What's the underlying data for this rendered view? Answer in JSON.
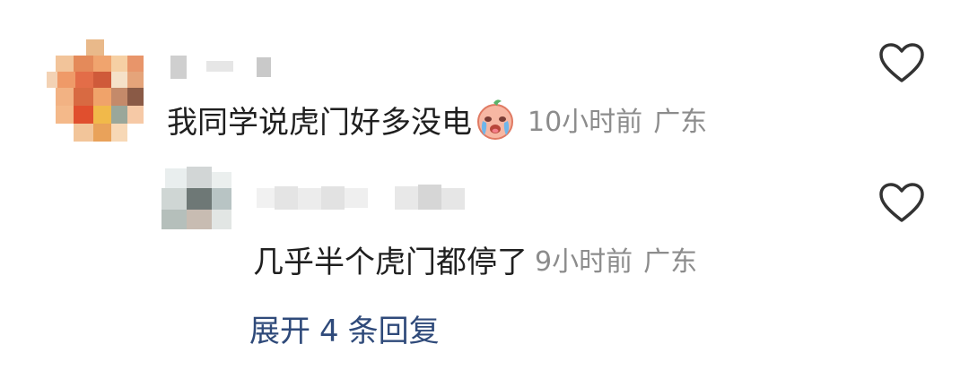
{
  "comment": {
    "text": "我同学说虎门好多没电",
    "emoji_icon": "crying-face-emoji",
    "time": "10小时前",
    "location": "广东"
  },
  "reply": {
    "text": "几乎半个虎门都停了",
    "time": "9小时前",
    "location": "广东"
  },
  "expand": {
    "label": "展开",
    "count": "4",
    "suffix": "条回复"
  },
  "icons": {
    "like": "heart-outline-icon"
  }
}
